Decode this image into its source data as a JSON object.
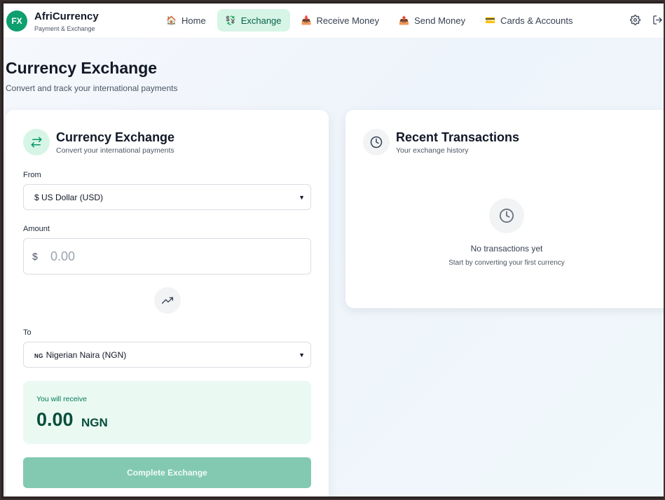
{
  "brand": {
    "badge": "FX",
    "title": "AfriCurrency",
    "subtitle": "Payment & Exchange"
  },
  "nav": [
    {
      "label": "Home",
      "icon": "🏠",
      "active": false
    },
    {
      "label": "Exchange",
      "icon": "💱",
      "active": true
    },
    {
      "label": "Receive Money",
      "icon": "📥",
      "active": false
    },
    {
      "label": "Send Money",
      "icon": "📤",
      "active": false
    },
    {
      "label": "Cards & Accounts",
      "icon": "💳",
      "active": false
    }
  ],
  "header_icons": [
    "gear-icon",
    "logout-icon"
  ],
  "page": {
    "title": "Currency Exchange",
    "subtitle": "Convert and track your international payments"
  },
  "exchange": {
    "title": "Currency Exchange",
    "subtitle": "Convert your international payments",
    "from_label": "From",
    "from_value": "$ US Dollar (USD)",
    "amount_label": "Amount",
    "amount_symbol": "$",
    "amount_placeholder": "0.00",
    "to_label": "To",
    "to_flag": "NG",
    "to_value": "Nigerian Naira (NGN)",
    "receive_label": "You will receive",
    "receive_value": "0.00",
    "receive_currency": "NGN",
    "complete_button": "Complete Exchange"
  },
  "recent": {
    "title": "Recent Transactions",
    "subtitle": "Your exchange history",
    "empty_title": "No transactions yet",
    "empty_subtitle": "Start by converting your first currency"
  },
  "colors": {
    "accent": "#0e9f6e",
    "accent_light": "#d6f5e7",
    "receive_bg": "#eafaf3",
    "button_disabled": "#83c9b1"
  }
}
